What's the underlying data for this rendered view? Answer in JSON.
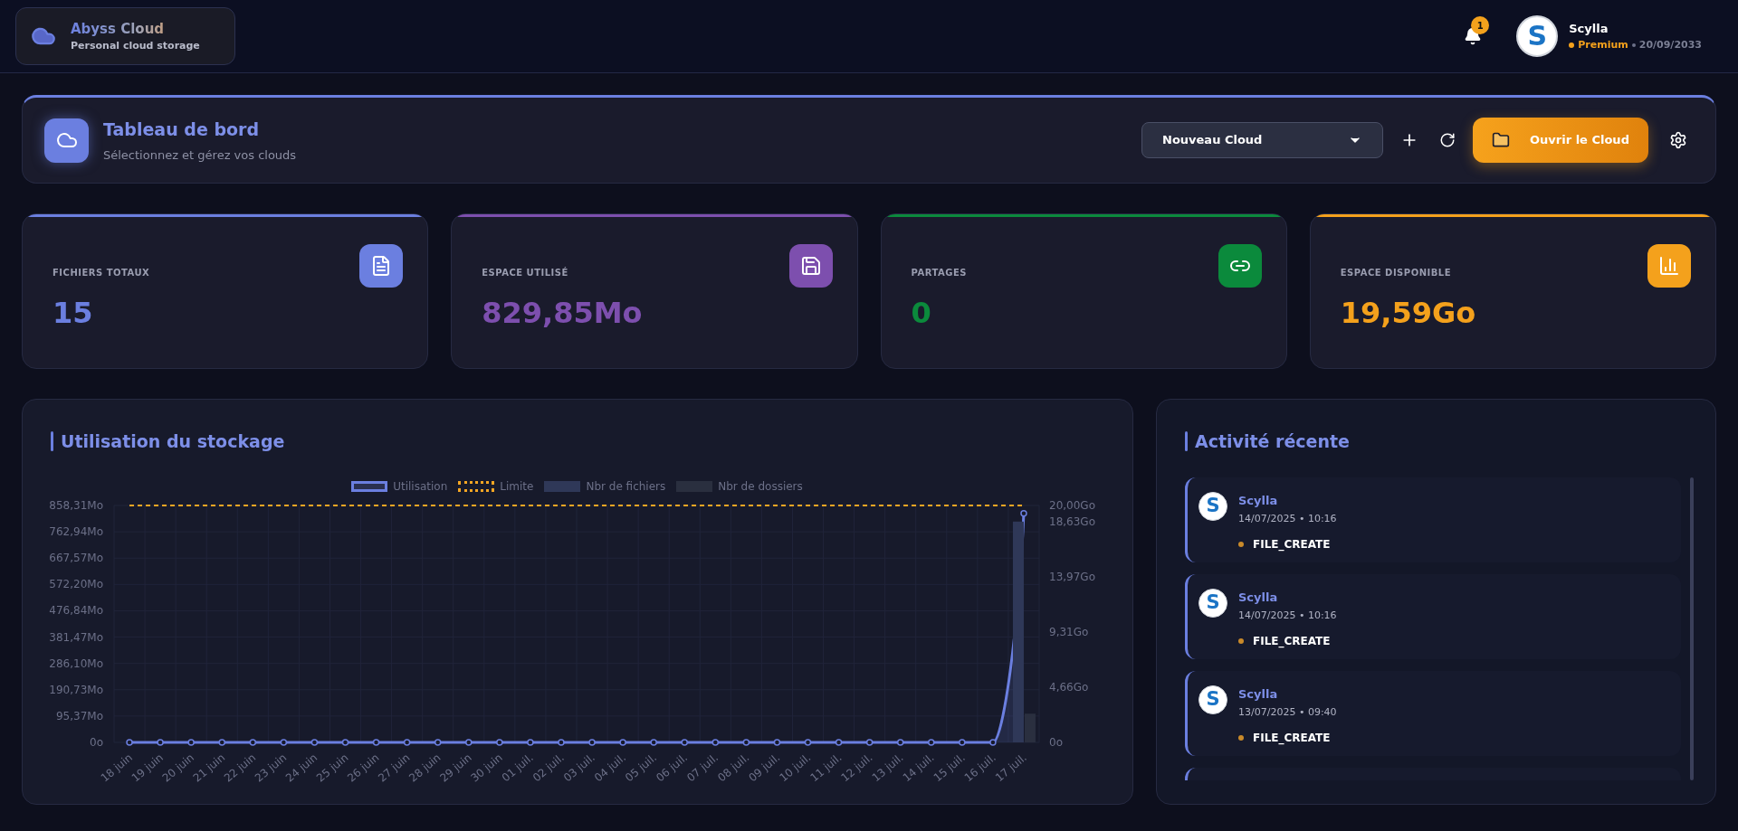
{
  "header": {
    "brand": {
      "name": "Abyss Cloud",
      "tagline": "Personal cloud storage"
    },
    "notifications": {
      "count": "1"
    },
    "user": {
      "avatar_letter": "S",
      "name": "Scylla",
      "plan": "Premium",
      "expiry": "20/09/2033"
    }
  },
  "dashboard": {
    "title": "Tableau de bord",
    "subtitle": "Sélectionnez et gérez vos clouds",
    "cloud_select": {
      "value": "Nouveau Cloud"
    },
    "open_button": "Ouvrir le Cloud"
  },
  "stats": [
    {
      "label": "FICHIERS TOTAUX",
      "value": "15",
      "color": "#6b7fe0",
      "kind": "files"
    },
    {
      "label": "ESPACE UTILISÉ",
      "value": "829,85Mo",
      "color": "#7d4fae",
      "kind": "used"
    },
    {
      "label": "PARTAGES",
      "value": "0",
      "color": "#0b8a3c",
      "kind": "shares"
    },
    {
      "label": "ESPACE DISPONIBLE",
      "value": "19,59Go",
      "color": "#f4a11c",
      "kind": "free"
    }
  ],
  "storage_chart": {
    "title": "Utilisation du stockage",
    "chart_data": {
      "type": "line",
      "legend": "top",
      "categories": [
        "18 juin",
        "19 juin",
        "20 juin",
        "21 juin",
        "22 juin",
        "23 juin",
        "24 juin",
        "25 juin",
        "26 juin",
        "27 juin",
        "28 juin",
        "29 juin",
        "30 juin",
        "01 juil.",
        "02 juil.",
        "03 juil.",
        "04 juil.",
        "05 juil.",
        "06 juil.",
        "07 juil.",
        "08 juil.",
        "09 juil.",
        "10 juil.",
        "11 juil.",
        "12 juil.",
        "13 juil.",
        "14 juil.",
        "15 juil.",
        "16 juil.",
        "17 juil."
      ],
      "series": [
        {
          "name": "Utilisation",
          "color": "#6b7fe0",
          "type": "area",
          "marker": "circle",
          "line_style": "solid",
          "values": [
            0,
            0,
            0,
            0,
            0,
            0,
            0,
            0,
            0,
            0,
            0,
            0,
            0,
            0,
            0,
            0,
            0,
            0,
            0,
            0,
            0,
            0,
            0,
            0,
            0,
            0,
            0,
            0,
            0,
            830
          ]
        },
        {
          "name": "Limite",
          "color": "#f5a623",
          "type": "line",
          "line_style": "dashed",
          "values": [
            858.31,
            858.31,
            858.31,
            858.31,
            858.31,
            858.31,
            858.31,
            858.31,
            858.31,
            858.31,
            858.31,
            858.31,
            858.31,
            858.31,
            858.31,
            858.31,
            858.31,
            858.31,
            858.31,
            858.31,
            858.31,
            858.31,
            858.31,
            858.31,
            858.31,
            858.31,
            858.31,
            858.31,
            858.31,
            858.31
          ]
        },
        {
          "name": "Nbr de fichiers",
          "color": "#2f3858",
          "type": "bar",
          "values": [
            null,
            null,
            null,
            null,
            null,
            null,
            null,
            null,
            null,
            null,
            null,
            null,
            null,
            null,
            null,
            null,
            null,
            null,
            null,
            null,
            null,
            null,
            null,
            null,
            null,
            null,
            null,
            null,
            null,
            800
          ]
        },
        {
          "name": "Nbr de dossiers",
          "color": "#2a2f3f",
          "type": "bar",
          "values": [
            null,
            null,
            null,
            null,
            null,
            null,
            null,
            null,
            null,
            null,
            null,
            null,
            null,
            null,
            null,
            null,
            null,
            null,
            null,
            null,
            null,
            null,
            null,
            null,
            null,
            null,
            null,
            null,
            null,
            104
          ]
        }
      ],
      "ylim": [
        0,
        858.31
      ],
      "yticks": [
        {
          "value": 0,
          "label": "0o"
        },
        {
          "value": 95.37,
          "label": "95,37Mo"
        },
        {
          "value": 190.73,
          "label": "190,73Mo"
        },
        {
          "value": 286.1,
          "label": "286,10Mo"
        },
        {
          "value": 381.47,
          "label": "381,47Mo"
        },
        {
          "value": 476.84,
          "label": "476,84Mo"
        },
        {
          "value": 572.2,
          "label": "572,20Mo"
        },
        {
          "value": 667.57,
          "label": "667,57Mo"
        },
        {
          "value": 762.94,
          "label": "762,94Mo"
        },
        {
          "value": 858.31,
          "label": "858,31Mo"
        }
      ],
      "y2lim": [
        0,
        20
      ],
      "y2ticks": [
        {
          "value": 0,
          "label": "0o"
        },
        {
          "value": 4.66,
          "label": "4,66Go"
        },
        {
          "value": 9.31,
          "label": "9,31Go"
        },
        {
          "value": 13.97,
          "label": "13,97Go"
        },
        {
          "value": 18.63,
          "label": "18,63Go"
        },
        {
          "value": 20,
          "label": "20,00Go"
        }
      ]
    }
  },
  "recent_activity": {
    "title": "Activité récente",
    "items": [
      {
        "avatar_letter": "S",
        "user": "Scylla",
        "time": "14/07/2025 • 10:16",
        "action": "FILE_CREATE"
      },
      {
        "avatar_letter": "S",
        "user": "Scylla",
        "time": "14/07/2025 • 10:16",
        "action": "FILE_CREATE"
      },
      {
        "avatar_letter": "S",
        "user": "Scylla",
        "time": "13/07/2025 • 09:40",
        "action": "FILE_CREATE"
      }
    ]
  }
}
